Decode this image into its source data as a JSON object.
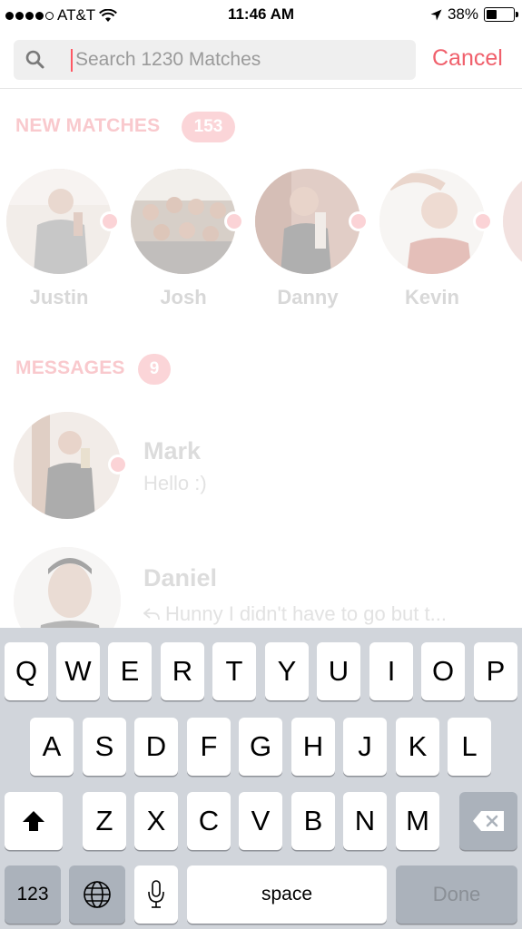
{
  "status_bar": {
    "carrier": "AT&T",
    "time": "11:46 AM",
    "battery": "38%"
  },
  "search": {
    "placeholder": "Search 1230 Matches",
    "value": "",
    "cancel_label": "Cancel"
  },
  "new_matches": {
    "title": "NEW MATCHES",
    "count": "153",
    "items": [
      {
        "name": "Justin"
      },
      {
        "name": "Josh"
      },
      {
        "name": "Danny"
      },
      {
        "name": "Kevin"
      }
    ]
  },
  "messages": {
    "title": "MESSAGES",
    "count": "9",
    "items": [
      {
        "name": "Mark",
        "preview": "Hello :)"
      },
      {
        "name": "Daniel",
        "preview": "Hunny I didn't have to go but t..."
      }
    ]
  },
  "keyboard": {
    "row1": [
      "Q",
      "W",
      "E",
      "R",
      "T",
      "Y",
      "U",
      "I",
      "O",
      "P"
    ],
    "row2": [
      "A",
      "S",
      "D",
      "F",
      "G",
      "H",
      "J",
      "K",
      "L"
    ],
    "row3": [
      "Z",
      "X",
      "C",
      "V",
      "B",
      "N",
      "M"
    ],
    "numbers_label": "123",
    "space_label": "space",
    "done_label": "Done"
  },
  "colors": {
    "accent": "#f0606c",
    "keyboard_bg": "#d1d5db",
    "search_bg": "#efefef"
  }
}
